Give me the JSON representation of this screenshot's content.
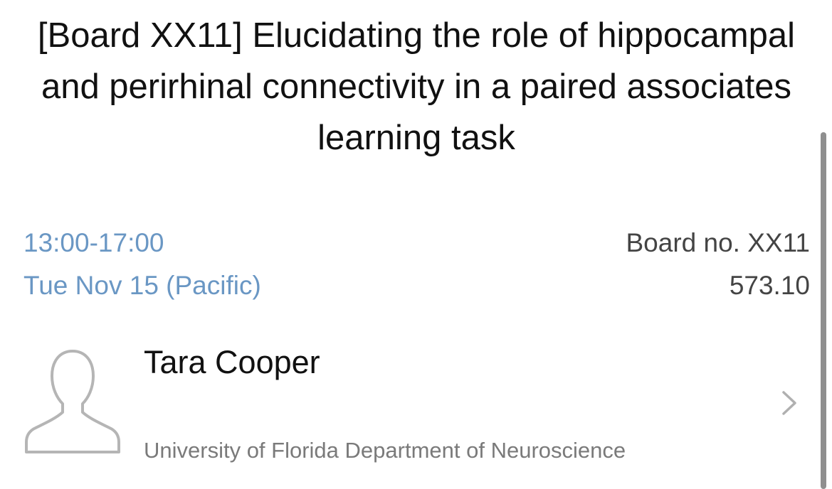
{
  "poster": {
    "title": "[Board XX11] Elucidating the role of hippocampal and perirhinal connectivity in a paired associates learning task",
    "time": "13:00-17:00",
    "date": "Tue Nov 15 (Pacific)",
    "board": "Board no. XX11",
    "code": "573.10"
  },
  "author": {
    "name": "Tara Cooper",
    "affiliation": "University of Florida Department of Neuroscience",
    "avatar_icon": "person-silhouette-icon",
    "chevron_icon": "chevron-right-icon"
  },
  "colors": {
    "accent": "#6a97c4",
    "text": "#111111",
    "secondary": "#7a7a7a",
    "icon": "#b5b5b5"
  }
}
